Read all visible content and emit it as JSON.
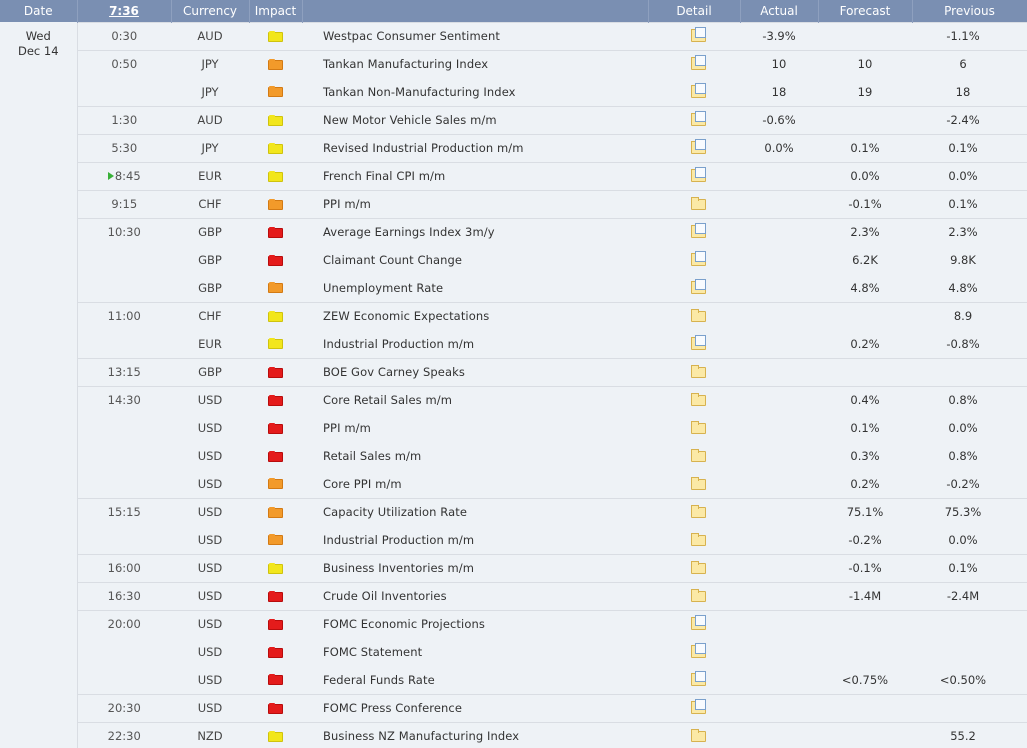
{
  "header": {
    "date": "Date",
    "time": "7:36",
    "currency": "Currency",
    "impact": "Impact",
    "detail": "Detail",
    "actual": "Actual",
    "forecast": "Forecast",
    "previous": "Previous"
  },
  "day": {
    "weekday": "Wed",
    "date": "Dec 14"
  },
  "colors": {
    "header_bg": "#7a8fb2",
    "page_bg": "#eef2f6",
    "high": "#e41b1b",
    "medium": "#f29a2a",
    "low": "#f2e61c",
    "actual_red": "#cc2a2a"
  },
  "events": [
    {
      "time": "0:30",
      "currency": "AUD",
      "impact": "low",
      "event": "Westpac Consumer Sentiment",
      "detail_icon": "detail-doc",
      "actual": "-3.9%",
      "forecast": "",
      "previous": "-1.1%"
    },
    {
      "time": "0:50",
      "currency": "JPY",
      "impact": "medium",
      "event": "Tankan Manufacturing Index",
      "detail_icon": "detail-doc",
      "actual": "10",
      "forecast": "10",
      "previous": "6"
    },
    {
      "time": "",
      "currency": "JPY",
      "impact": "medium",
      "event": "Tankan Non-Manufacturing Index",
      "detail_icon": "detail-doc",
      "actual": "18",
      "actual_red": true,
      "forecast": "19",
      "previous": "18"
    },
    {
      "time": "1:30",
      "currency": "AUD",
      "impact": "low",
      "event": "New Motor Vehicle Sales m/m",
      "detail_icon": "detail-doc",
      "actual": "-0.6%",
      "forecast": "",
      "previous": "-2.4%"
    },
    {
      "time": "5:30",
      "currency": "JPY",
      "impact": "low",
      "event": "Revised Industrial Production m/m",
      "detail_icon": "detail-doc",
      "actual": "0.0%",
      "actual_red": true,
      "forecast": "0.1%",
      "previous": "0.1%"
    },
    {
      "time": "8:45",
      "current": true,
      "currency": "EUR",
      "impact": "low",
      "event": "French Final CPI m/m",
      "detail_icon": "detail-doc",
      "actual": "",
      "forecast": "0.0%",
      "previous": "0.0%"
    },
    {
      "time": "9:15",
      "currency": "CHF",
      "impact": "medium",
      "event": "PPI m/m",
      "detail_icon": "detail-folder",
      "actual": "",
      "forecast": "-0.1%",
      "previous": "0.1%"
    },
    {
      "time": "10:30",
      "currency": "GBP",
      "impact": "high",
      "event": "Average Earnings Index 3m/y",
      "detail_icon": "detail-doc",
      "actual": "",
      "forecast": "2.3%",
      "previous": "2.3%"
    },
    {
      "time": "",
      "currency": "GBP",
      "impact": "high",
      "event": "Claimant Count Change",
      "detail_icon": "detail-doc",
      "actual": "",
      "forecast": "6.2K",
      "previous": "9.8K"
    },
    {
      "time": "",
      "currency": "GBP",
      "impact": "medium",
      "event": "Unemployment Rate",
      "detail_icon": "detail-doc",
      "actual": "",
      "forecast": "4.8%",
      "previous": "4.8%"
    },
    {
      "time": "11:00",
      "currency": "CHF",
      "impact": "low",
      "event": "ZEW Economic Expectations",
      "detail_icon": "detail-folder",
      "actual": "",
      "forecast": "",
      "previous": "8.9"
    },
    {
      "time": "",
      "currency": "EUR",
      "impact": "low",
      "event": "Industrial Production m/m",
      "detail_icon": "detail-doc",
      "actual": "",
      "forecast": "0.2%",
      "previous": "-0.8%"
    },
    {
      "time": "13:15",
      "currency": "GBP",
      "impact": "high",
      "event": "BOE Gov Carney Speaks",
      "detail_icon": "detail-folder",
      "actual": "",
      "forecast": "",
      "previous": ""
    },
    {
      "time": "14:30",
      "currency": "USD",
      "impact": "high",
      "event": "Core Retail Sales m/m",
      "detail_icon": "detail-folder",
      "actual": "",
      "forecast": "0.4%",
      "previous": "0.8%"
    },
    {
      "time": "",
      "currency": "USD",
      "impact": "high",
      "event": "PPI m/m",
      "detail_icon": "detail-folder",
      "actual": "",
      "forecast": "0.1%",
      "previous": "0.0%"
    },
    {
      "time": "",
      "currency": "USD",
      "impact": "high",
      "event": "Retail Sales m/m",
      "detail_icon": "detail-folder",
      "actual": "",
      "forecast": "0.3%",
      "previous": "0.8%"
    },
    {
      "time": "",
      "currency": "USD",
      "impact": "medium",
      "event": "Core PPI m/m",
      "detail_icon": "detail-folder",
      "actual": "",
      "forecast": "0.2%",
      "previous": "-0.2%"
    },
    {
      "time": "15:15",
      "currency": "USD",
      "impact": "medium",
      "event": "Capacity Utilization Rate",
      "detail_icon": "detail-folder",
      "actual": "",
      "forecast": "75.1%",
      "previous": "75.3%"
    },
    {
      "time": "",
      "currency": "USD",
      "impact": "medium",
      "event": "Industrial Production m/m",
      "detail_icon": "detail-folder",
      "actual": "",
      "forecast": "-0.2%",
      "previous": "0.0%"
    },
    {
      "time": "16:00",
      "currency": "USD",
      "impact": "low",
      "event": "Business Inventories m/m",
      "detail_icon": "detail-folder",
      "actual": "",
      "forecast": "-0.1%",
      "previous": "0.1%"
    },
    {
      "time": "16:30",
      "currency": "USD",
      "impact": "high",
      "event": "Crude Oil Inventories",
      "detail_icon": "detail-folder",
      "actual": "",
      "forecast": "-1.4M",
      "previous": "-2.4M"
    },
    {
      "time": "20:00",
      "currency": "USD",
      "impact": "high",
      "event": "FOMC Economic Projections",
      "detail_icon": "detail-doc",
      "actual": "",
      "forecast": "",
      "previous": ""
    },
    {
      "time": "",
      "currency": "USD",
      "impact": "high",
      "event": "FOMC Statement",
      "detail_icon": "detail-doc",
      "actual": "",
      "forecast": "",
      "previous": ""
    },
    {
      "time": "",
      "currency": "USD",
      "impact": "high",
      "event": "Federal Funds Rate",
      "detail_icon": "detail-doc",
      "actual": "",
      "forecast": "<0.75%",
      "previous": "<0.50%"
    },
    {
      "time": "20:30",
      "currency": "USD",
      "impact": "high",
      "event": "FOMC Press Conference",
      "detail_icon": "detail-doc",
      "actual": "",
      "forecast": "",
      "previous": ""
    },
    {
      "time": "22:30",
      "currency": "NZD",
      "impact": "low",
      "event": "Business NZ Manufacturing Index",
      "detail_icon": "detail-folder",
      "actual": "",
      "forecast": "",
      "previous": "55.2"
    }
  ]
}
